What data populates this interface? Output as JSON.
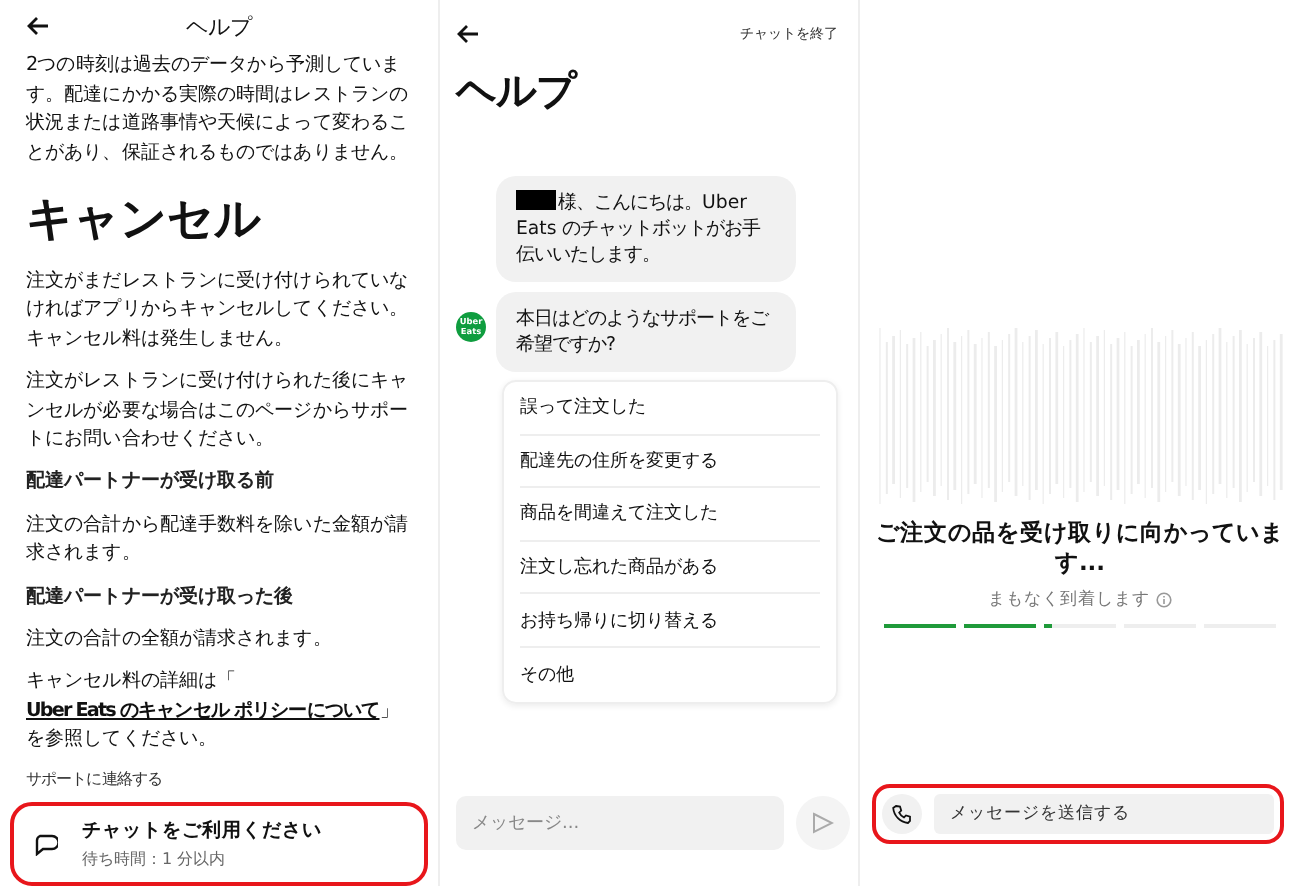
{
  "help_panel": {
    "title": "ヘルプ",
    "intro": "2つの時刻は過去のデータから予測しています。配達にかかる実際の時間はレストランの状況または道路事情や天候によって変わることがあり、保証されるものではありません。",
    "heading": "キャンセル",
    "sections": [
      {
        "kind": "paragraph",
        "text": "注文がまだレストランに受け付けられていなければアプリからキャンセルしてください。キャンセル料は発生しません。"
      },
      {
        "kind": "paragraph",
        "text": "注文がレストランに受け付けられた後にキャンセルが必要な場合はこのページからサポートにお問い合わせください。"
      },
      {
        "kind": "subheading",
        "text": "配達パートナーが受け取る前"
      },
      {
        "kind": "paragraph",
        "text": "注文の合計から配達手数料を除いた金額が請求されます。"
      },
      {
        "kind": "subheading",
        "text": "配達パートナーが受け取った後"
      },
      {
        "kind": "paragraph",
        "text": "注文の合計の全額が請求されます。"
      }
    ],
    "policy_note": {
      "before": "キャンセル料の詳細は「",
      "link": "Uber Eats のキャンセル ポリシーについて",
      "after": "」を参照してください。"
    },
    "contact_label": "サポートに連絡する",
    "chat_card": {
      "title": "チャットをご利用ください",
      "wait": "待ち時間：1 分以内",
      "highlighted": true
    }
  },
  "chat_panel": {
    "end_chat": "チャットを終了",
    "title": "ヘルプ",
    "messages": [
      {
        "redacted_name": true,
        "text": "様、こんにちは。Uber Eats のチャットボットがお手伝いいたします。"
      },
      {
        "redacted_name": false,
        "text": "本日はどのようなサポートをご希望ですか?"
      }
    ],
    "avatar_label": "Uber Eats",
    "options": [
      "誤って注文した",
      "配達先の住所を変更する",
      "商品を間違えて注文した",
      "注文し忘れた商品がある",
      "お持ち帰りに切り替える",
      "その他"
    ],
    "input": {
      "placeholder": "メッセージ..."
    }
  },
  "status_panel": {
    "title": "ご注文の品を受け取りに向かっています...",
    "subtitle": "まもなく到着します",
    "progress": [
      {
        "level": 1
      },
      {
        "level": 1
      },
      {
        "level": 0.1
      },
      {
        "level": 0
      },
      {
        "level": 0
      }
    ],
    "message_bar": {
      "placeholder": "メッセージを送信する",
      "highlighted": true
    }
  }
}
